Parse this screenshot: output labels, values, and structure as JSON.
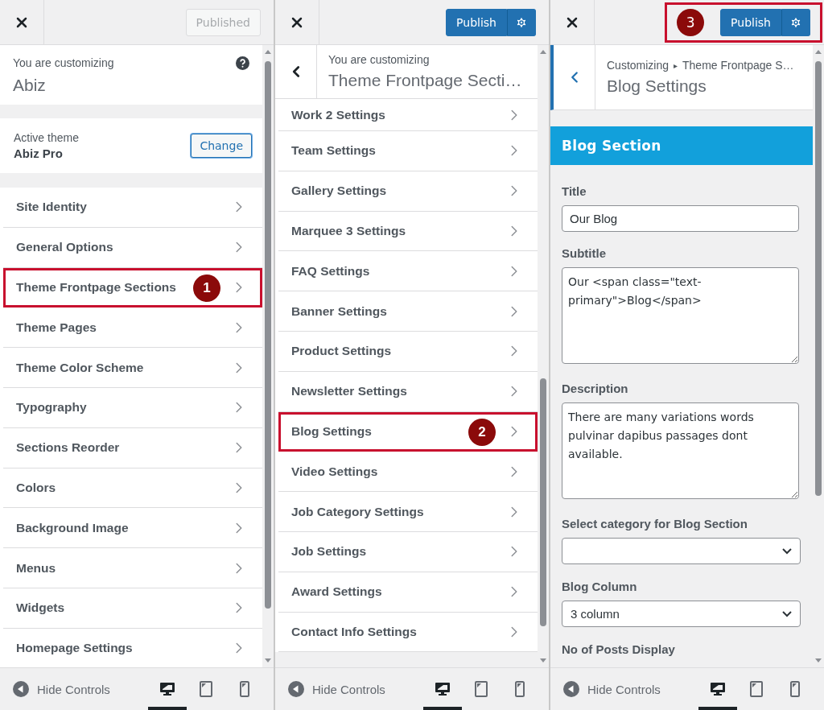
{
  "panels": [
    {
      "kind": "root",
      "header": {
        "publish": {
          "label": "Published",
          "disabled": true
        }
      },
      "info": {
        "eyebrow": "You are customizing",
        "title": "Abiz"
      },
      "theme": {
        "label": "Active theme",
        "name": "Abiz Pro",
        "button": "Change"
      },
      "items": [
        {
          "label": "Site Identity",
          "highlighted": false
        },
        {
          "label": "General Options",
          "highlighted": false
        },
        {
          "label": "Theme Frontpage Sections",
          "highlighted": true,
          "marker": "1"
        },
        {
          "label": "Theme Pages",
          "highlighted": false
        },
        {
          "label": "Theme Color Scheme",
          "highlighted": false
        },
        {
          "label": "Typography",
          "highlighted": false
        },
        {
          "label": "Sections Reorder",
          "highlighted": false
        },
        {
          "label": "Colors",
          "highlighted": false
        },
        {
          "label": "Background Image",
          "highlighted": false
        },
        {
          "label": "Menus",
          "highlighted": false
        },
        {
          "label": "Widgets",
          "highlighted": false
        },
        {
          "label": "Homepage Settings",
          "highlighted": false
        }
      ],
      "footer": {
        "toggle": "Hide Controls",
        "devices": [
          {
            "kind": "desktop",
            "selected": true
          },
          {
            "kind": "tablet",
            "selected": false
          },
          {
            "kind": "mobile",
            "selected": false
          }
        ]
      }
    },
    {
      "kind": "section",
      "header": {
        "publish": {
          "label": "Publish",
          "disabled": false
        }
      },
      "info": {
        "eyebrow": "You are customizing",
        "title": "Theme Frontpage Secti…"
      },
      "items": [
        {
          "label": "Work 2 Settings",
          "highlighted": false
        },
        {
          "label": "Team Settings",
          "highlighted": false
        },
        {
          "label": "Gallery Settings",
          "highlighted": false
        },
        {
          "label": "Marquee 3 Settings",
          "highlighted": false
        },
        {
          "label": "FAQ Settings",
          "highlighted": false
        },
        {
          "label": "Banner Settings",
          "highlighted": false
        },
        {
          "label": "Product Settings",
          "highlighted": false
        },
        {
          "label": "Newsletter Settings",
          "highlighted": false
        },
        {
          "label": "Blog Settings",
          "highlighted": true,
          "marker": "2"
        },
        {
          "label": "Video Settings",
          "highlighted": false
        },
        {
          "label": "Job Category Settings",
          "highlighted": false
        },
        {
          "label": "Job Settings",
          "highlighted": false
        },
        {
          "label": "Award Settings",
          "highlighted": false
        },
        {
          "label": "Contact Info Settings",
          "highlighted": false
        }
      ],
      "footer": {
        "toggle": "Hide Controls",
        "devices": [
          {
            "kind": "desktop",
            "selected": true
          },
          {
            "kind": "tablet",
            "selected": false
          },
          {
            "kind": "mobile",
            "selected": false
          }
        ]
      }
    },
    {
      "kind": "settings",
      "header": {
        "publish": {
          "label": "Publish",
          "disabled": false
        },
        "highlighted": true,
        "marker": "3"
      },
      "info": {
        "breadcrumb": [
          "Customizing",
          "Theme Frontpage S…"
        ],
        "separator": "▸",
        "title": "Blog Settings"
      },
      "section_title": "Blog Section",
      "fields": [
        {
          "kind": "input",
          "label": "Title",
          "value": "Our Blog"
        },
        {
          "kind": "textarea",
          "label": "Subtitle",
          "value": "Our <span class=\"text-primary\">Blog</span>"
        },
        {
          "kind": "textarea",
          "label": "Description",
          "value": "There are many variations words pulvinar dapibus passages dont available."
        },
        {
          "kind": "select",
          "label": "Select category for Blog Section"
        },
        {
          "kind": "select",
          "label": "Blog Column",
          "value": "3 column"
        },
        {
          "kind": "label",
          "label": "No of Posts Display"
        }
      ],
      "footer": {
        "toggle": "Hide Controls",
        "devices": [
          {
            "kind": "desktop",
            "selected": true
          },
          {
            "kind": "tablet",
            "selected": false
          },
          {
            "kind": "mobile",
            "selected": false
          }
        ]
      }
    }
  ]
}
